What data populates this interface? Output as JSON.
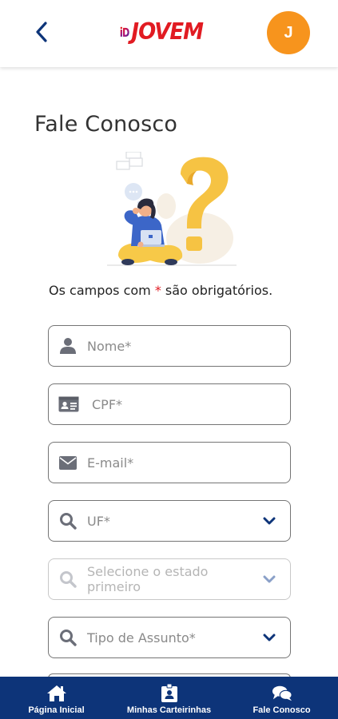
{
  "header": {
    "logo_text": "JOVEM",
    "logo_mark": "iD",
    "avatar_initial": "J"
  },
  "page": {
    "title": "Fale Conosco",
    "required_note_prefix": "Os campos com ",
    "required_note_star": "*",
    "required_note_suffix": " são obrigatórios."
  },
  "form": {
    "nome_placeholder": "Nome*",
    "cpf_placeholder": "CPF*",
    "email_placeholder": "E-mail*",
    "uf_placeholder": "UF*",
    "cidade_placeholder": "Selecione o estado primeiro",
    "assunto_placeholder": "Tipo de Assunto*"
  },
  "bottom_nav": {
    "items": [
      {
        "label": "Página Inicial",
        "icon": "home-icon"
      },
      {
        "label": "Minhas Carteirinhas",
        "icon": "id-badge-icon"
      },
      {
        "label": "Fale Conosco",
        "icon": "chat-bubbles-icon"
      }
    ]
  },
  "colors": {
    "brand_red": "#e11b22",
    "brand_blue": "#0d3479",
    "avatar_orange": "#f7941d",
    "chevron_blue": "#0d3479",
    "field_border": "#757575"
  }
}
